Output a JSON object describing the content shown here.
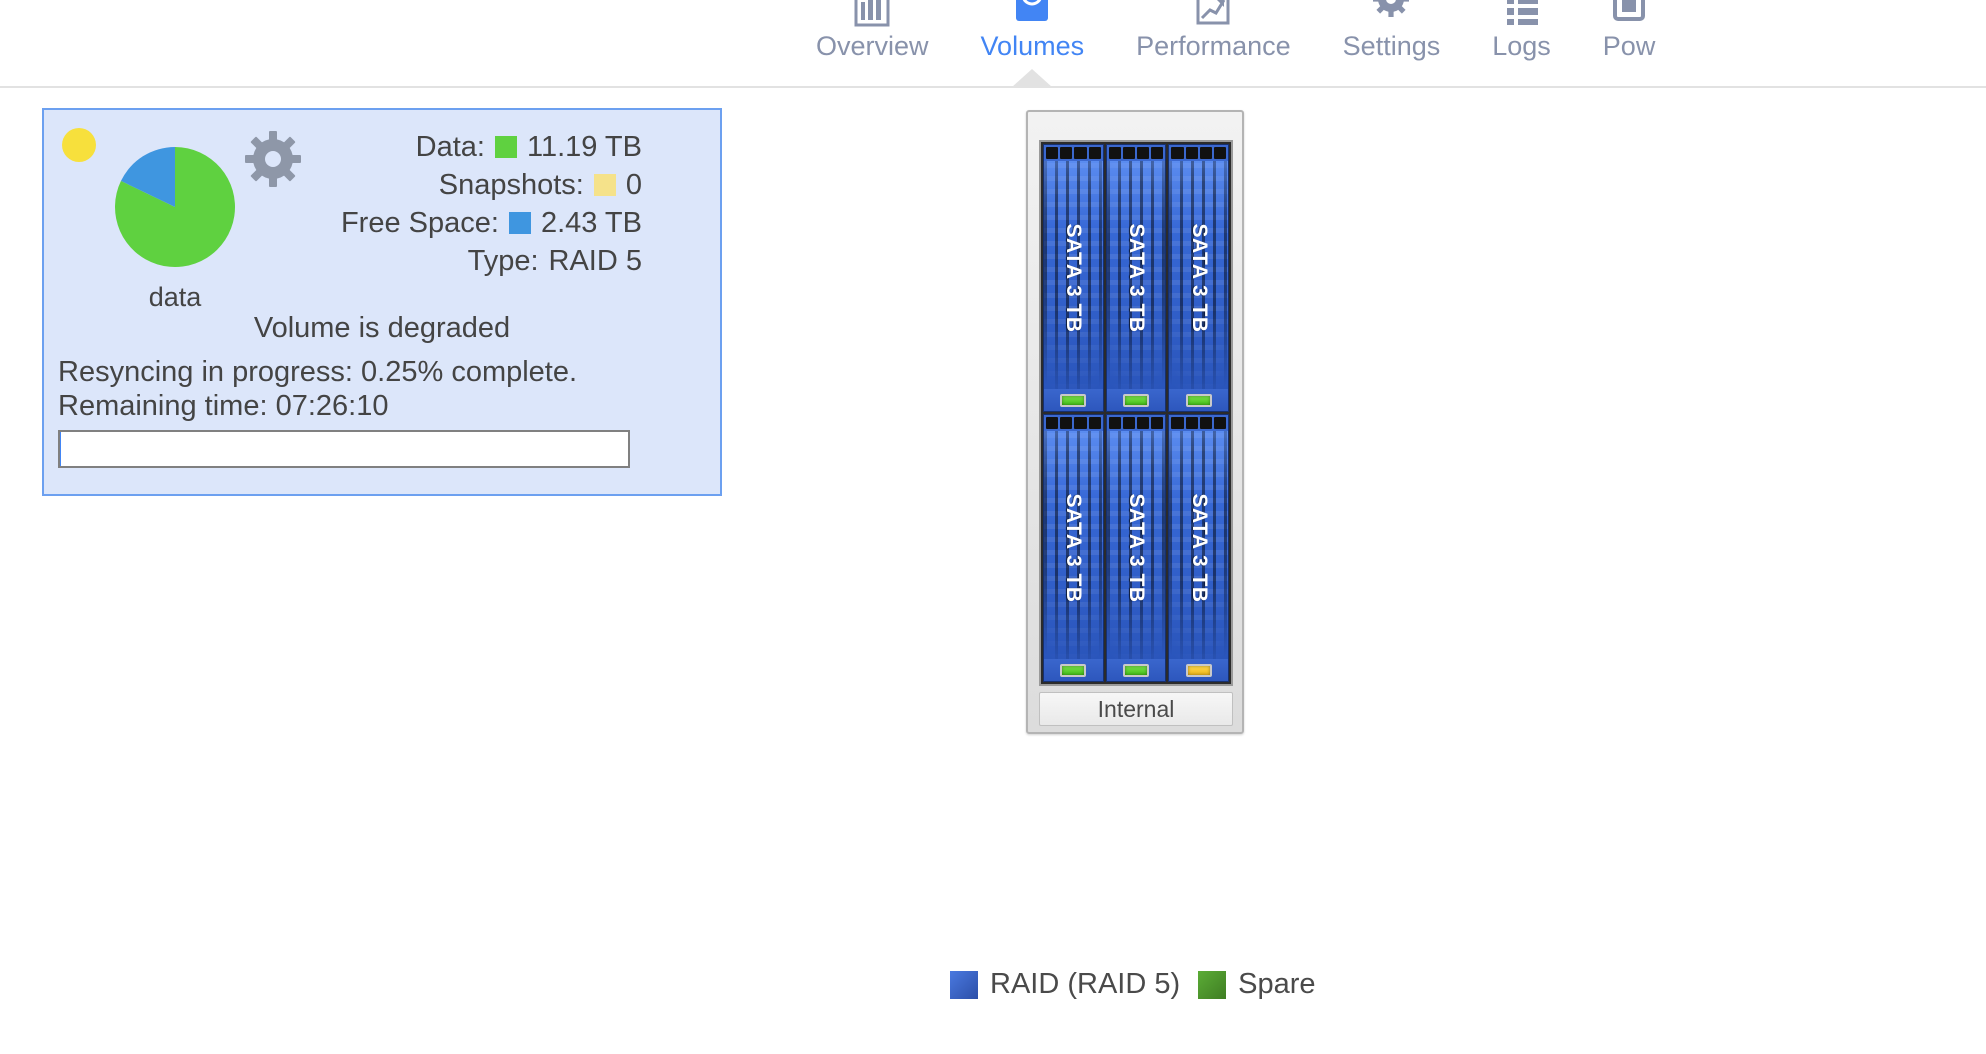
{
  "tabs": [
    {
      "label": "Overview",
      "icon": "bar-chart-icon",
      "active": false
    },
    {
      "label": "Volumes",
      "icon": "volumes-icon",
      "active": true
    },
    {
      "label": "Performance",
      "icon": "line-graph-icon",
      "active": false
    },
    {
      "label": "Settings",
      "icon": "gear-icon",
      "active": false
    },
    {
      "label": "Logs",
      "icon": "list-icon",
      "active": false
    },
    {
      "label": "Pow",
      "icon": "power-icon",
      "active": false
    }
  ],
  "volume": {
    "name": "data",
    "status_dot_color": "#f7e03c",
    "rows": [
      {
        "key": "Data:",
        "swatch": "#5fd140",
        "value": "11.19 TB"
      },
      {
        "key": "Snapshots:",
        "swatch": "#f5e28a",
        "value": "0"
      },
      {
        "key": "Free Space:",
        "swatch": "#3f96e0",
        "value": "2.43 TB"
      },
      {
        "key": "Type:",
        "swatch": null,
        "value": "RAID 5"
      }
    ],
    "degraded_message": "Volume is degraded",
    "resync_text": "Resyncing in progress: 0.25% complete.",
    "remaining_text": "Remaining time: 07:26:10",
    "progress_percent": 0.25,
    "gear_icon": "gear-icon"
  },
  "chart_data": {
    "type": "pie",
    "title": "data",
    "categories": [
      "Data",
      "Free Space"
    ],
    "values": [
      11.19,
      2.43
    ],
    "unit": "TB",
    "percentages": [
      82.2,
      17.8
    ],
    "colors": [
      "#5fd140",
      "#3f96e0"
    ],
    "legend": "inline-rows"
  },
  "enclosure": {
    "footer_label": "Internal",
    "drives": [
      {
        "label": "SATA 3 TB",
        "led": "green"
      },
      {
        "label": "SATA 3 TB",
        "led": "green"
      },
      {
        "label": "SATA 3 TB",
        "led": "green"
      },
      {
        "label": "SATA 3 TB",
        "led": "green"
      },
      {
        "label": "SATA 3 TB",
        "led": "green"
      },
      {
        "label": "SATA 3 TB",
        "led": "amber"
      }
    ]
  },
  "legend": [
    {
      "label": "RAID (RAID 5)",
      "color": "#3a63c8"
    },
    {
      "label": "Spare",
      "color": "#4f9b2e"
    }
  ]
}
